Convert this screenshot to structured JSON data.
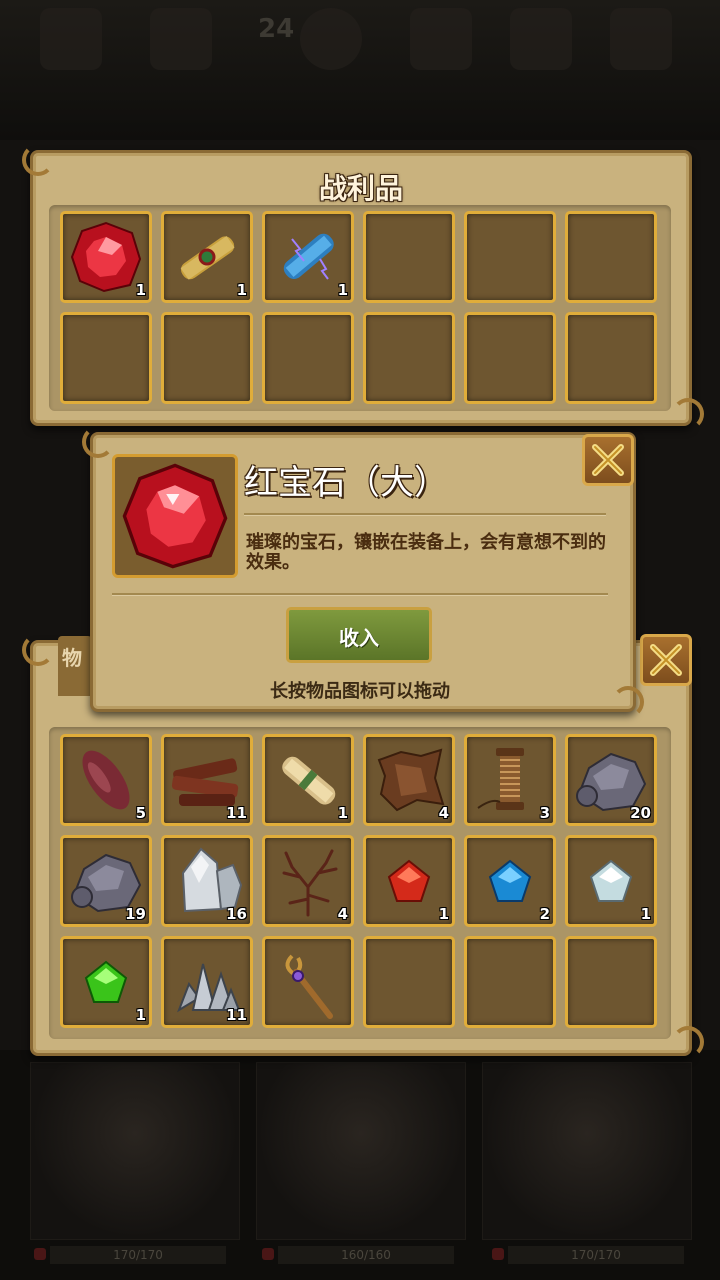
{
  "hud": {
    "level": "24"
  },
  "loot_panel": {
    "title": "战利品",
    "slots": [
      {
        "item": "ruby-large-icon",
        "count": "1"
      },
      {
        "item": "green-scroll-icon",
        "count": "1"
      },
      {
        "item": "blue-scroll-icon",
        "count": "1"
      },
      {
        "item": "",
        "count": ""
      },
      {
        "item": "",
        "count": ""
      },
      {
        "item": "",
        "count": ""
      },
      {
        "item": "",
        "count": ""
      },
      {
        "item": "",
        "count": ""
      },
      {
        "item": "",
        "count": ""
      },
      {
        "item": "",
        "count": ""
      },
      {
        "item": "",
        "count": ""
      },
      {
        "item": "",
        "count": ""
      }
    ]
  },
  "detail_popup": {
    "item_name": "红宝石（大）",
    "item_icon": "ruby-large-icon",
    "description": "璀璨的宝石，镶嵌在装备上，会有意想不到的效果。",
    "collect_label": "收入",
    "hint": "长按物品图标可以拖动"
  },
  "inventory_panel": {
    "tab_label": "物",
    "slots": [
      {
        "item": "sweet-potato-icon",
        "count": "5"
      },
      {
        "item": "wood-bark-icon",
        "count": "11"
      },
      {
        "item": "paper-scroll-icon",
        "count": "1"
      },
      {
        "item": "leather-hide-icon",
        "count": "4"
      },
      {
        "item": "thread-spool-icon",
        "count": "3"
      },
      {
        "item": "iron-ore-icon",
        "count": "20"
      },
      {
        "item": "iron-ore-icon",
        "count": "19"
      },
      {
        "item": "silver-ore-icon",
        "count": "16"
      },
      {
        "item": "dry-branch-icon",
        "count": "4"
      },
      {
        "item": "red-gem-small-icon",
        "count": "1"
      },
      {
        "item": "blue-gem-small-icon",
        "count": "2"
      },
      {
        "item": "white-gem-small-icon",
        "count": "1"
      },
      {
        "item": "green-gem-small-icon",
        "count": "1"
      },
      {
        "item": "crystal-cluster-icon",
        "count": "11"
      },
      {
        "item": "magic-staff-icon",
        "count": ""
      },
      {
        "item": "",
        "count": ""
      },
      {
        "item": "",
        "count": ""
      },
      {
        "item": "",
        "count": ""
      }
    ]
  },
  "heroes": [
    {
      "hp": "170/170"
    },
    {
      "hp": "160/160"
    },
    {
      "hp": "170/170"
    }
  ],
  "colors": {
    "panel": "#c9b27e",
    "slot_border": "#e0ad3a",
    "collect_button": "#6f8a34"
  }
}
